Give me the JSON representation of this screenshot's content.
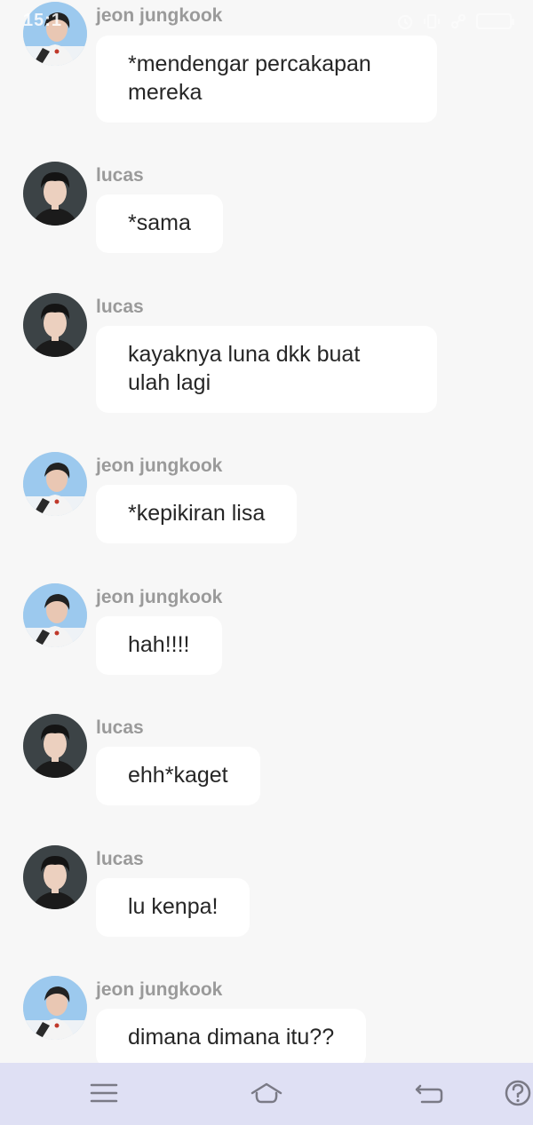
{
  "status_bar": {
    "time": "15:1"
  },
  "messages": [
    {
      "sender": "jeon jungkook",
      "text": "*mendengar percakapan mereka",
      "avatar": "jungkook"
    },
    {
      "sender": "lucas",
      "text": "*sama",
      "avatar": "lucas"
    },
    {
      "sender": "lucas",
      "text": "kayaknya luna dkk buat ulah lagi",
      "avatar": "lucas"
    },
    {
      "sender": "jeon jungkook",
      "text": "*kepikiran lisa",
      "avatar": "jungkook"
    },
    {
      "sender": "jeon jungkook",
      "text": "hah!!!!",
      "avatar": "jungkook"
    },
    {
      "sender": "lucas",
      "text": "ehh*kaget",
      "avatar": "lucas"
    },
    {
      "sender": "lucas",
      "text": "lu kenpa!",
      "avatar": "lucas"
    },
    {
      "sender": "jeon jungkook",
      "text": "dimana dimana itu??",
      "avatar": "jungkook"
    }
  ],
  "nav_bar": {
    "icons": [
      "menu-icon",
      "home-icon",
      "back-icon",
      "help-icon"
    ]
  },
  "colors": {
    "background": "#f7f7f7",
    "bubble": "#ffffff",
    "sender_name": "#9a9a9a",
    "message_text": "#262626",
    "nav_bar": "#dfe0f4"
  }
}
